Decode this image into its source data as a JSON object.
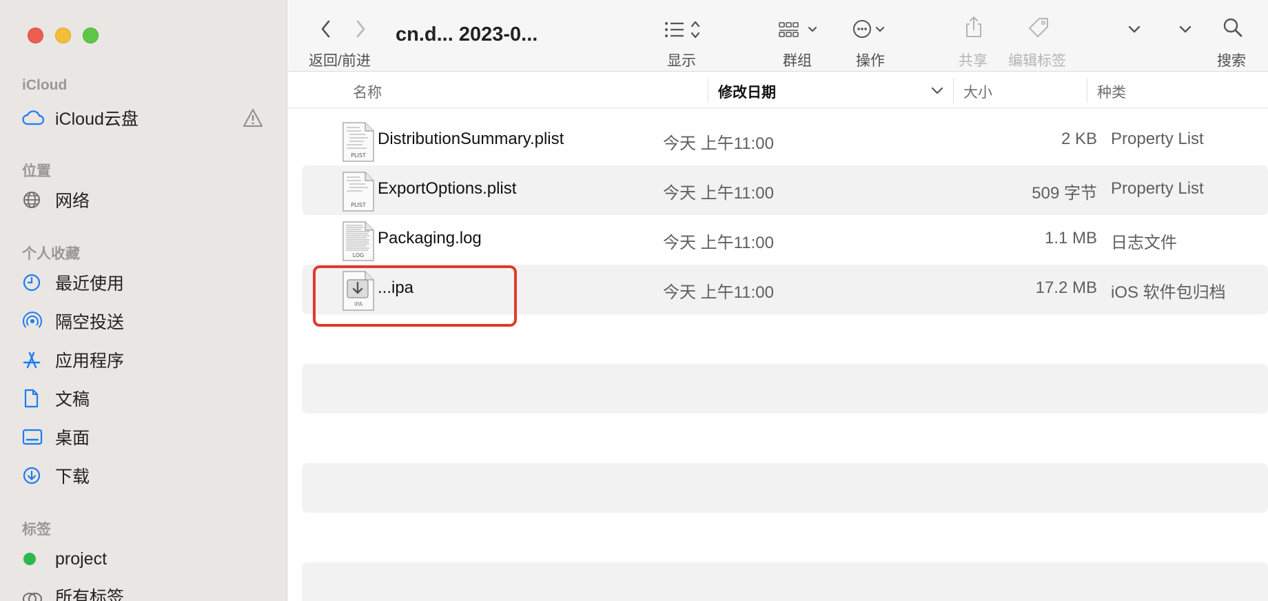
{
  "window": {
    "title": "cn.d... 2023-0...",
    "traffic_lights": {
      "close": "#ee5d53",
      "minimize": "#f4be3a",
      "zoom": "#5fc748"
    }
  },
  "toolbar": {
    "nav_label": "返回/前进",
    "view_label": "显示",
    "group_label": "群组",
    "action_label": "操作",
    "share_label": "共享",
    "tags_label": "编辑标签",
    "search_label": "搜索"
  },
  "sidebar": {
    "sections": {
      "icloud": "iCloud",
      "locations": "位置",
      "favorites": "个人收藏",
      "tags": "标签"
    },
    "items": [
      {
        "label": "iCloud云盘",
        "icon": "cloud-icon"
      },
      {
        "label": "网络",
        "icon": "globe-icon"
      },
      {
        "label": "最近使用",
        "icon": "clock-icon"
      },
      {
        "label": "隔空投送",
        "icon": "airdrop-icon"
      },
      {
        "label": "应用程序",
        "icon": "apps-icon"
      },
      {
        "label": "文稿",
        "icon": "document-icon"
      },
      {
        "label": "桌面",
        "icon": "desktop-icon"
      },
      {
        "label": "下载",
        "icon": "download-icon"
      },
      {
        "label": "project",
        "icon": "green-tag-dot",
        "color": "#2db84d"
      },
      {
        "label": "所有标签",
        "icon": "all-tags-icon"
      }
    ]
  },
  "columns": {
    "name": "名称",
    "date": "修改日期",
    "size": "大小",
    "kind": "种类"
  },
  "files": [
    {
      "name": "DistributionSummary.plist",
      "date": "今天 上午11:00",
      "size": "2 KB",
      "kind": "Property List",
      "badge": "PLIST"
    },
    {
      "name": "ExportOptions.plist",
      "date": "今天 上午11:00",
      "size": "509 字节",
      "kind": "Property List",
      "badge": "PLIST"
    },
    {
      "name": "Packaging.log",
      "date": "今天 上午11:00",
      "size": "1.1 MB",
      "kind": "日志文件",
      "badge": "LOG"
    },
    {
      "name": "...ipa",
      "date": "今天 上午11:00",
      "size": "17.2 MB",
      "kind": "iOS 软件包归档",
      "badge": "IPA"
    }
  ],
  "colors": {
    "accent": "#1a7cf5",
    "highlight": "#e03a2f",
    "stripe": "#f2f2f2",
    "sidebar_bg": "#e9e6e3"
  }
}
